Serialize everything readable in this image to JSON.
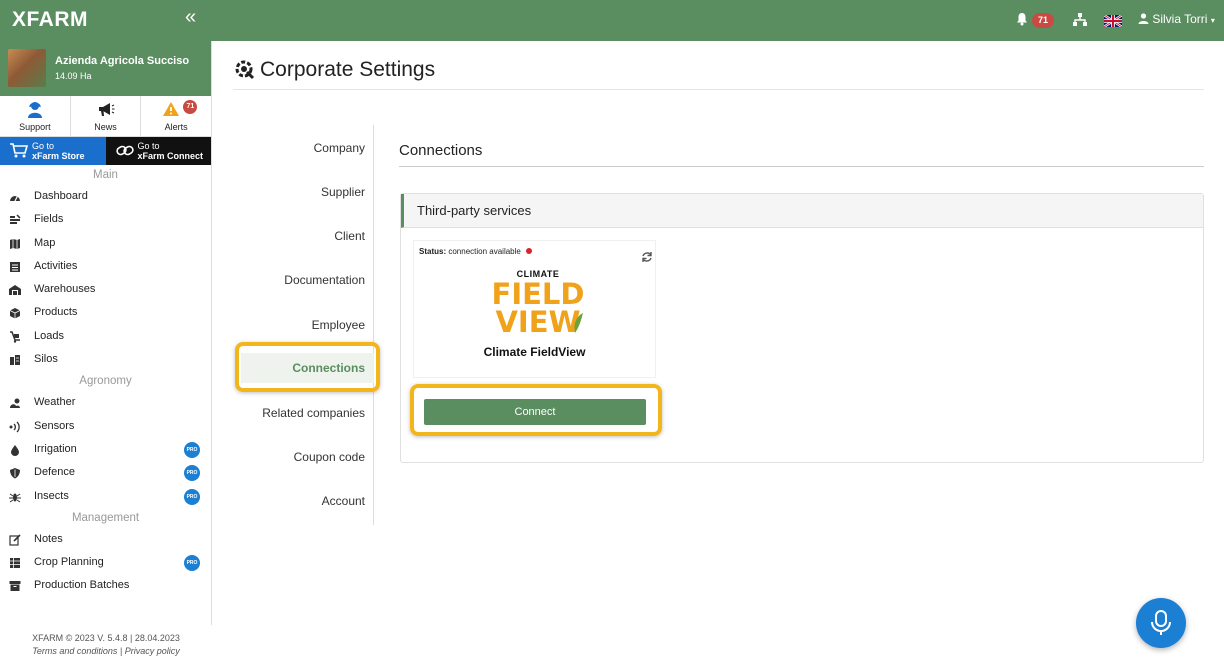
{
  "topbar": {
    "brand": "XFARM",
    "collapse_icon": "«",
    "notifications_count": "71",
    "language": "en-GB",
    "user_name": "Silvia Torri"
  },
  "sidebar": {
    "farm_name": "Azienda Agricola Succiso",
    "farm_area": "14.09 Ha",
    "quick": [
      {
        "label": "Support",
        "icon": "support-icon"
      },
      {
        "label": "News",
        "icon": "megaphone-icon"
      },
      {
        "label": "Alerts",
        "icon": "warning-icon",
        "badge": "71"
      }
    ],
    "store": {
      "line1": "Go to",
      "line2": "xFarm Store"
    },
    "connect": {
      "line1": "Go to",
      "line2": "xFarm Connect"
    },
    "sections": {
      "main": "Main",
      "agronomy": "Agronomy",
      "management": "Management"
    },
    "main_items": [
      {
        "label": "Dashboard",
        "icon": "dashboard-icon"
      },
      {
        "label": "Fields",
        "icon": "fields-icon"
      },
      {
        "label": "Map",
        "icon": "map-icon"
      },
      {
        "label": "Activities",
        "icon": "activities-icon"
      },
      {
        "label": "Warehouses",
        "icon": "warehouse-icon"
      },
      {
        "label": "Products",
        "icon": "products-icon"
      },
      {
        "label": "Loads",
        "icon": "loads-icon"
      },
      {
        "label": "Silos",
        "icon": "silos-icon"
      }
    ],
    "agronomy_items": [
      {
        "label": "Weather",
        "icon": "weather-icon"
      },
      {
        "label": "Sensors",
        "icon": "sensors-icon"
      },
      {
        "label": "Irrigation",
        "icon": "irrigation-icon",
        "pro": true
      },
      {
        "label": "Defence",
        "icon": "shield-icon",
        "pro": true
      },
      {
        "label": "Insects",
        "icon": "insect-icon",
        "pro": true
      }
    ],
    "management_items": [
      {
        "label": "Notes",
        "icon": "notes-icon"
      },
      {
        "label": "Crop Planning",
        "icon": "crop-planning-icon",
        "pro": true
      },
      {
        "label": "Production Batches",
        "icon": "batches-icon"
      }
    ],
    "pro_label": "PRO",
    "footer": {
      "line1": "XFARM © 2023 V. 5.4.8 | 28.04.2023",
      "terms": "Terms and conditions",
      "separator": "|",
      "privacy": "Privacy policy"
    }
  },
  "page": {
    "title": "Corporate Settings",
    "title_icon": "settings-icon"
  },
  "subnav": {
    "items": [
      "Company",
      "Supplier",
      "Client",
      "Documentation",
      "Employee",
      "Connections",
      "Related companies",
      "Coupon code",
      "Account"
    ],
    "active_index": 5
  },
  "connections": {
    "heading": "Connections",
    "panel_title": "Third-party services",
    "card": {
      "status_label": "Status:",
      "status_value": "connection available",
      "status_color": "#d8242b",
      "logo_top": "CLIMATE",
      "logo_mid": "FIELD",
      "logo_bottom": "VIEW",
      "name": "Climate FieldView",
      "button": "Connect"
    }
  },
  "colors": {
    "brand_green": "#5a8d5f",
    "highlight": "#f2b51c",
    "pro_blue": "#1b7fd4"
  }
}
